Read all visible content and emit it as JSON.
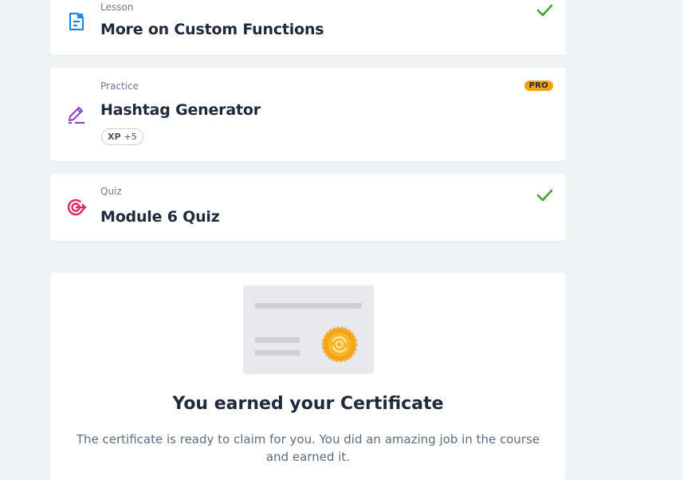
{
  "items": [
    {
      "type": "Lesson",
      "title": "More on Custom Functions",
      "status": "completed",
      "icon": "lesson-icon"
    },
    {
      "type": "Practice",
      "title": "Hashtag Generator",
      "badge": "PRO",
      "xp_label": "XP",
      "xp_value": "+5",
      "icon": "practice-pencil-icon"
    },
    {
      "type": "Quiz",
      "title": "Module 6 Quiz",
      "status": "completed",
      "icon": "quiz-target-icon"
    }
  ],
  "certificate": {
    "title": "You earned your Certificate",
    "description": "The certificate is ready to claim for you. You did an amazing job in the course and earned it."
  },
  "colors": {
    "check": "#3fa82b",
    "lesson_icon": "#1e88e5",
    "practice_icon": "#8a3fc9",
    "quiz_icon": "#e0245e",
    "pro_badge": "#f5a316",
    "seal": "#f5a316"
  }
}
